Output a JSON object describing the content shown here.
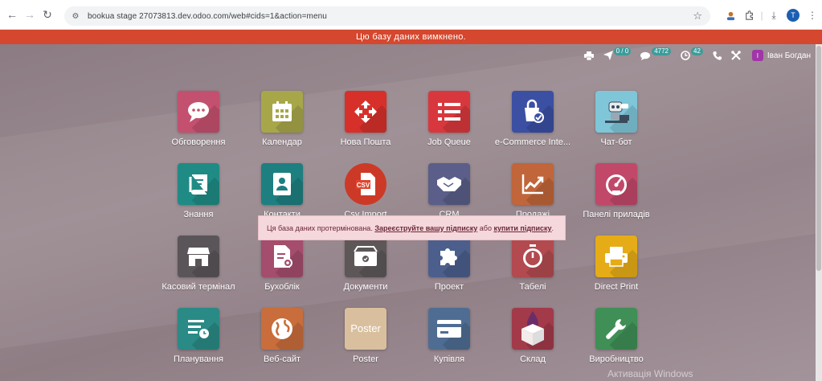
{
  "browser": {
    "url": "bookua stage 27073813.dev.odoo.com/web#cids=1&action=menu",
    "profile_initial": "T"
  },
  "banner": {
    "text": "Цю базу даних вимкнено."
  },
  "systray": {
    "activities_count": "0 / 0",
    "messages_count": "4772",
    "timer_count": "42",
    "user_initial": "I",
    "user_name": "Іван Богдан"
  },
  "apps": [
    {
      "label": "Обговорення",
      "icon": "chat-icon",
      "color": "#c4506f"
    },
    {
      "label": "Календар",
      "icon": "calendar-icon",
      "color": "#a7a74a"
    },
    {
      "label": "Нова Пошта",
      "icon": "nova-poshta-icon",
      "color": "#d7302b"
    },
    {
      "label": "Job Queue",
      "icon": "list-icon",
      "color": "#d8383d"
    },
    {
      "label": "e-Commerce Inte...",
      "icon": "ecommerce-icon",
      "color": "#3b4fa3"
    },
    {
      "label": "Чат-бот",
      "icon": "robot-icon",
      "color": "#7fc6d9"
    },
    {
      "label": "Знання",
      "icon": "book-icon",
      "color": "#1f8b84"
    },
    {
      "label": "Контакти",
      "icon": "contacts-icon",
      "color": "#1e7f80"
    },
    {
      "label": "Csv Import",
      "icon": "csv-icon",
      "color": "#cc3a27"
    },
    {
      "label": "CRM",
      "icon": "handshake-icon",
      "color": "#5a5e88"
    },
    {
      "label": "Продажі",
      "icon": "chart-icon",
      "color": "#c0663a"
    },
    {
      "label": "Панелі приладів",
      "icon": "gauge-icon",
      "color": "#c14869"
    },
    {
      "label": "Касовий термінал",
      "icon": "store-icon",
      "color": "#5a5558"
    },
    {
      "label": "Бухоблік",
      "icon": "accounting-icon",
      "color": "#a44d6d"
    },
    {
      "label": "Документи",
      "icon": "documents-icon",
      "color": "#5d5758"
    },
    {
      "label": "Проект",
      "icon": "puzzle-icon",
      "color": "#4c5f8c"
    },
    {
      "label": "Табелі",
      "icon": "stopwatch-icon",
      "color": "#b24a4f"
    },
    {
      "label": "Direct Print",
      "icon": "printer-icon",
      "color": "#e6ac17"
    },
    {
      "label": "Планування",
      "icon": "planning-icon",
      "color": "#2a8a86"
    },
    {
      "label": "Веб-сайт",
      "icon": "globe-icon",
      "color": "#c86d3b"
    },
    {
      "label": "Poster",
      "icon": "poster-icon",
      "color": "#d7bb98"
    },
    {
      "label": "Купівля",
      "icon": "card-icon",
      "color": "#4f6d93"
    },
    {
      "label": "Склад",
      "icon": "box-icon",
      "color": "#a23a4a"
    },
    {
      "label": "Виробництво",
      "icon": "wrench-icon",
      "color": "#3f8f56"
    }
  ],
  "notice": {
    "prefix": "Ця база даних протермінована.",
    "register_link": "Зареєструйте вашу підписку",
    "middle": "або",
    "buy_link": "купити підписку",
    "suffix": "."
  },
  "watermark": "Активація Windows"
}
